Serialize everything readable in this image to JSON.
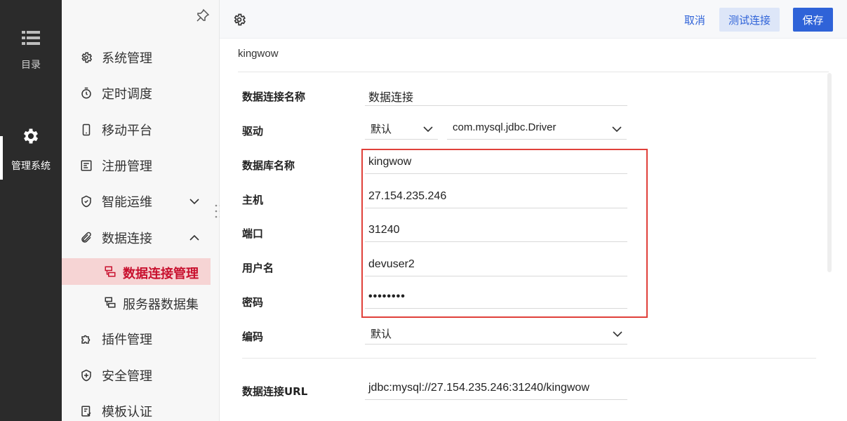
{
  "rail": {
    "items": [
      {
        "label": "目录",
        "icon": "list-icon"
      },
      {
        "label": "管理系统",
        "icon": "gear-icon"
      }
    ]
  },
  "sidebar": {
    "items": [
      {
        "label": "系统管理",
        "icon": "gear-outline-icon"
      },
      {
        "label": "定时调度",
        "icon": "timer-icon"
      },
      {
        "label": "移动平台",
        "icon": "phone-icon"
      },
      {
        "label": "注册管理",
        "icon": "register-icon"
      },
      {
        "label": "智能运维",
        "icon": "ops-icon",
        "expandable": true
      },
      {
        "label": "数据连接",
        "icon": "paperclip-icon",
        "expanded": true
      },
      {
        "label": "插件管理",
        "icon": "puzzle-icon"
      },
      {
        "label": "安全管理",
        "icon": "shield-icon"
      },
      {
        "label": "模板认证",
        "icon": "template-icon"
      }
    ],
    "subitems": [
      {
        "label": "数据连接管理",
        "active": true
      },
      {
        "label": "服务器数据集",
        "active": false
      }
    ]
  },
  "header": {
    "cancel_label": "取消",
    "test_label": "测试连接",
    "save_label": "保存"
  },
  "main": {
    "breadcrumb": "kingwow",
    "form": {
      "conn_name_label": "数据连接名称",
      "conn_name_value": "数据连接",
      "driver_label": "驱动",
      "driver_mode": "默认",
      "driver_class": "com.mysql.jdbc.Driver",
      "db_name_label": "数据库名称",
      "db_name_value": "kingwow",
      "host_label": "主机",
      "host_value": "27.154.235.246",
      "port_label": "端口",
      "port_value": "31240",
      "user_label": "用户名",
      "user_value": "devuser2",
      "password_label": "密码",
      "password_value": "••••••••",
      "encoding_label": "编码",
      "encoding_value": "默认",
      "url_label": "数据连接URL",
      "url_value": "jdbc:mysql://27.154.235.246:31240/kingwow"
    }
  },
  "colors": {
    "accent": "#2f63d8",
    "active_menu": "#c8102e",
    "highlight_border": "#e0403a",
    "rail_bg": "#2b2b2b"
  }
}
